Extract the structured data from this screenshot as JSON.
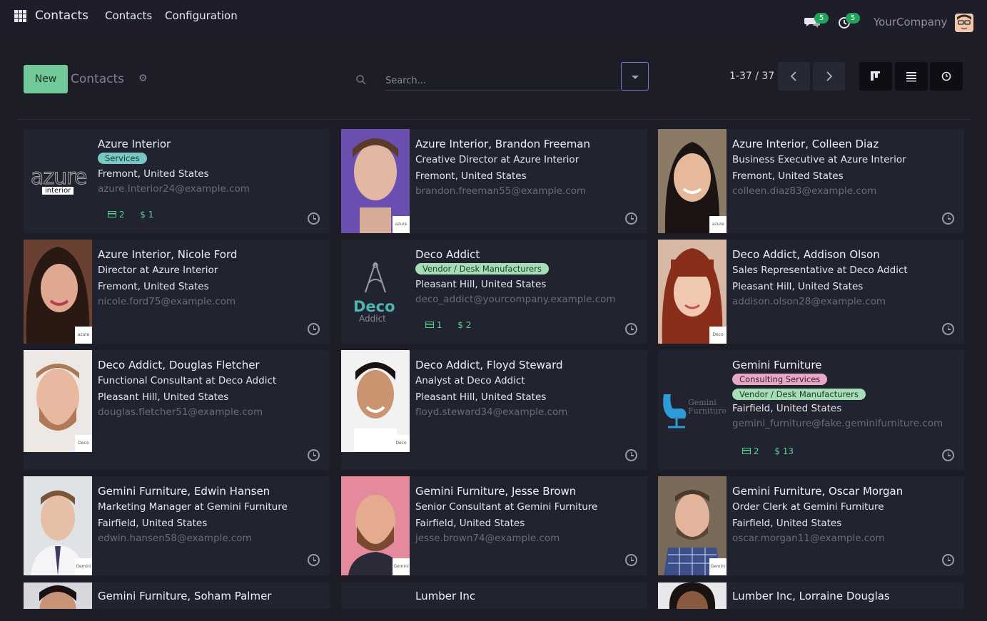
{
  "navbar": {
    "app_name": "Contacts",
    "menu": [
      "Contacts",
      "Configuration"
    ],
    "messages_count": "5",
    "activities_count": "5",
    "company": "YourCompany"
  },
  "control": {
    "new_label": "New",
    "breadcrumb": "Contacts",
    "search_placeholder": "Search...",
    "pager": "1-37 / 37"
  },
  "cards": [
    {
      "name": "Azure Interior",
      "tags": [
        "Services"
      ],
      "function": "",
      "location": "Fremont, United States",
      "email": "azure.Interior24@example.com",
      "meetings": "2",
      "amount": "$ 1",
      "logo_text": "azure",
      "logo_sub": "interior",
      "mini": ""
    },
    {
      "name": "Azure Interior, Brandon Freeman",
      "tags": [],
      "function": "Creative Director at Azure Interior",
      "location": "Fremont, United States",
      "email": "brandon.freeman55@example.com",
      "mini": "azure"
    },
    {
      "name": "Azure Interior, Colleen Diaz",
      "tags": [],
      "function": "Business Executive at Azure Interior",
      "location": "Fremont, United States",
      "email": "colleen.diaz83@example.com",
      "mini": "azure"
    },
    {
      "name": "Azure Interior, Nicole Ford",
      "tags": [],
      "function": "Director at Azure Interior",
      "location": "Fremont, United States",
      "email": "nicole.ford75@example.com",
      "mini": "azure"
    },
    {
      "name": "Deco Addict",
      "tags": [
        "Vendor / Desk Manufacturers"
      ],
      "function": "",
      "location": "Pleasant Hill, United States",
      "email": "deco_addict@yourcompany.example.com",
      "meetings": "1",
      "amount": "$ 2",
      "logo_text": "Deco",
      "logo_sub": "Addict"
    },
    {
      "name": "Deco Addict, Addison Olson",
      "tags": [],
      "function": "Sales Representative at Deco Addict",
      "location": "Pleasant Hill, United States",
      "email": "addison.olson28@example.com",
      "mini": "Deco"
    },
    {
      "name": "Deco Addict, Douglas Fletcher",
      "tags": [],
      "function": "Functional Consultant at Deco Addict",
      "location": "Pleasant Hill, United States",
      "email": "douglas.fletcher51@example.com",
      "mini": "Deco"
    },
    {
      "name": "Deco Addict, Floyd Steward",
      "tags": [],
      "function": "Analyst at Deco Addict",
      "location": "Pleasant Hill, United States",
      "email": "floyd.steward34@example.com",
      "mini": "Deco"
    },
    {
      "name": "Gemini Furniture",
      "tags": [
        "Consulting Services",
        "Vendor / Desk Manufacturers"
      ],
      "function": "",
      "location": "Fairfield, United States",
      "email": "gemini_furniture@fake.geminifurniture.com",
      "meetings": "2",
      "amount": "$ 13",
      "logo_text": "Gemini",
      "logo_sub": "Furniture"
    },
    {
      "name": "Gemini Furniture, Edwin Hansen",
      "tags": [],
      "function": "Marketing Manager at Gemini Furniture",
      "location": "Fairfield, United States",
      "email": "edwin.hansen58@example.com",
      "mini": "Gemini"
    },
    {
      "name": "Gemini Furniture, Jesse Brown",
      "tags": [],
      "function": "Senior Consultant at Gemini Furniture",
      "location": "Fairfield, United States",
      "email": "jesse.brown74@example.com",
      "mini": "Gemini"
    },
    {
      "name": "Gemini Furniture, Oscar Morgan",
      "tags": [],
      "function": "Order Clerk at Gemini Furniture",
      "location": "Fairfield, United States",
      "email": "oscar.morgan11@example.com",
      "mini": "Gemini"
    },
    {
      "name": "Gemini Furniture, Soham Palmer",
      "tags": [],
      "function": "",
      "location": "",
      "email": ""
    },
    {
      "name": "Lumber Inc",
      "tags": [],
      "function": "",
      "location": "",
      "email": ""
    },
    {
      "name": "Lumber Inc, Lorraine Douglas",
      "tags": [],
      "function": "",
      "location": "",
      "email": ""
    }
  ]
}
